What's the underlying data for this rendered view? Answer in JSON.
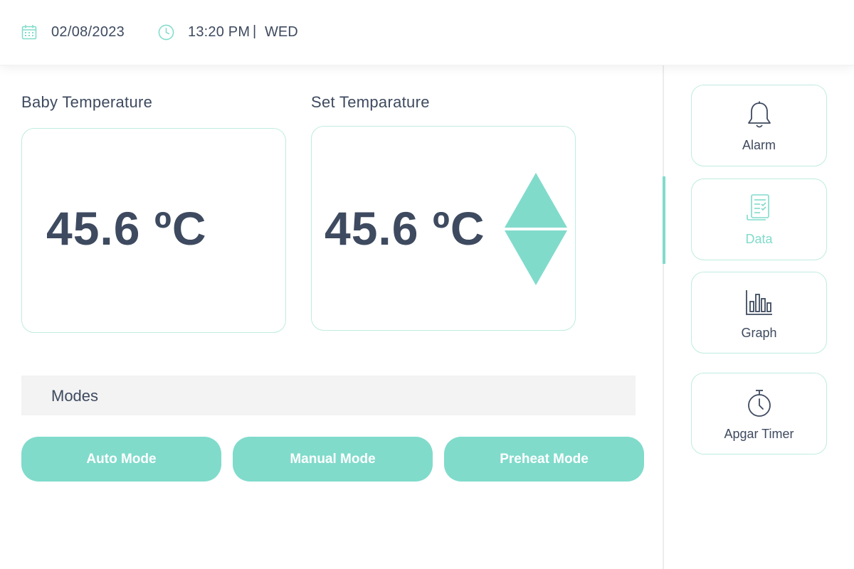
{
  "header": {
    "date": "02/08/2023",
    "time": "13:20 PM",
    "separator": "|",
    "day": "WED"
  },
  "baby_temperature": {
    "label": "Baby Temperature",
    "value": "45.6 ºC"
  },
  "set_temperature": {
    "label": "Set Temparature",
    "value": "45.6 ºC"
  },
  "modes": {
    "title": "Modes",
    "buttons": [
      "Auto Mode",
      "Manual Mode",
      "Preheat Mode"
    ]
  },
  "sidebar": {
    "items": [
      {
        "label": "Alarm",
        "icon": "bell-icon",
        "active": false
      },
      {
        "label": "Data",
        "icon": "document-checklist-icon",
        "active": true
      },
      {
        "label": "Graph",
        "icon": "bar-chart-icon",
        "active": false
      },
      {
        "label": "Apgar Timer",
        "icon": "stopwatch-icon",
        "active": false
      }
    ]
  },
  "colors": {
    "accent": "#80dbcb",
    "text": "#3e4a5f",
    "card_border": "#bfece0",
    "modes_bar": "#f3f3f3"
  }
}
